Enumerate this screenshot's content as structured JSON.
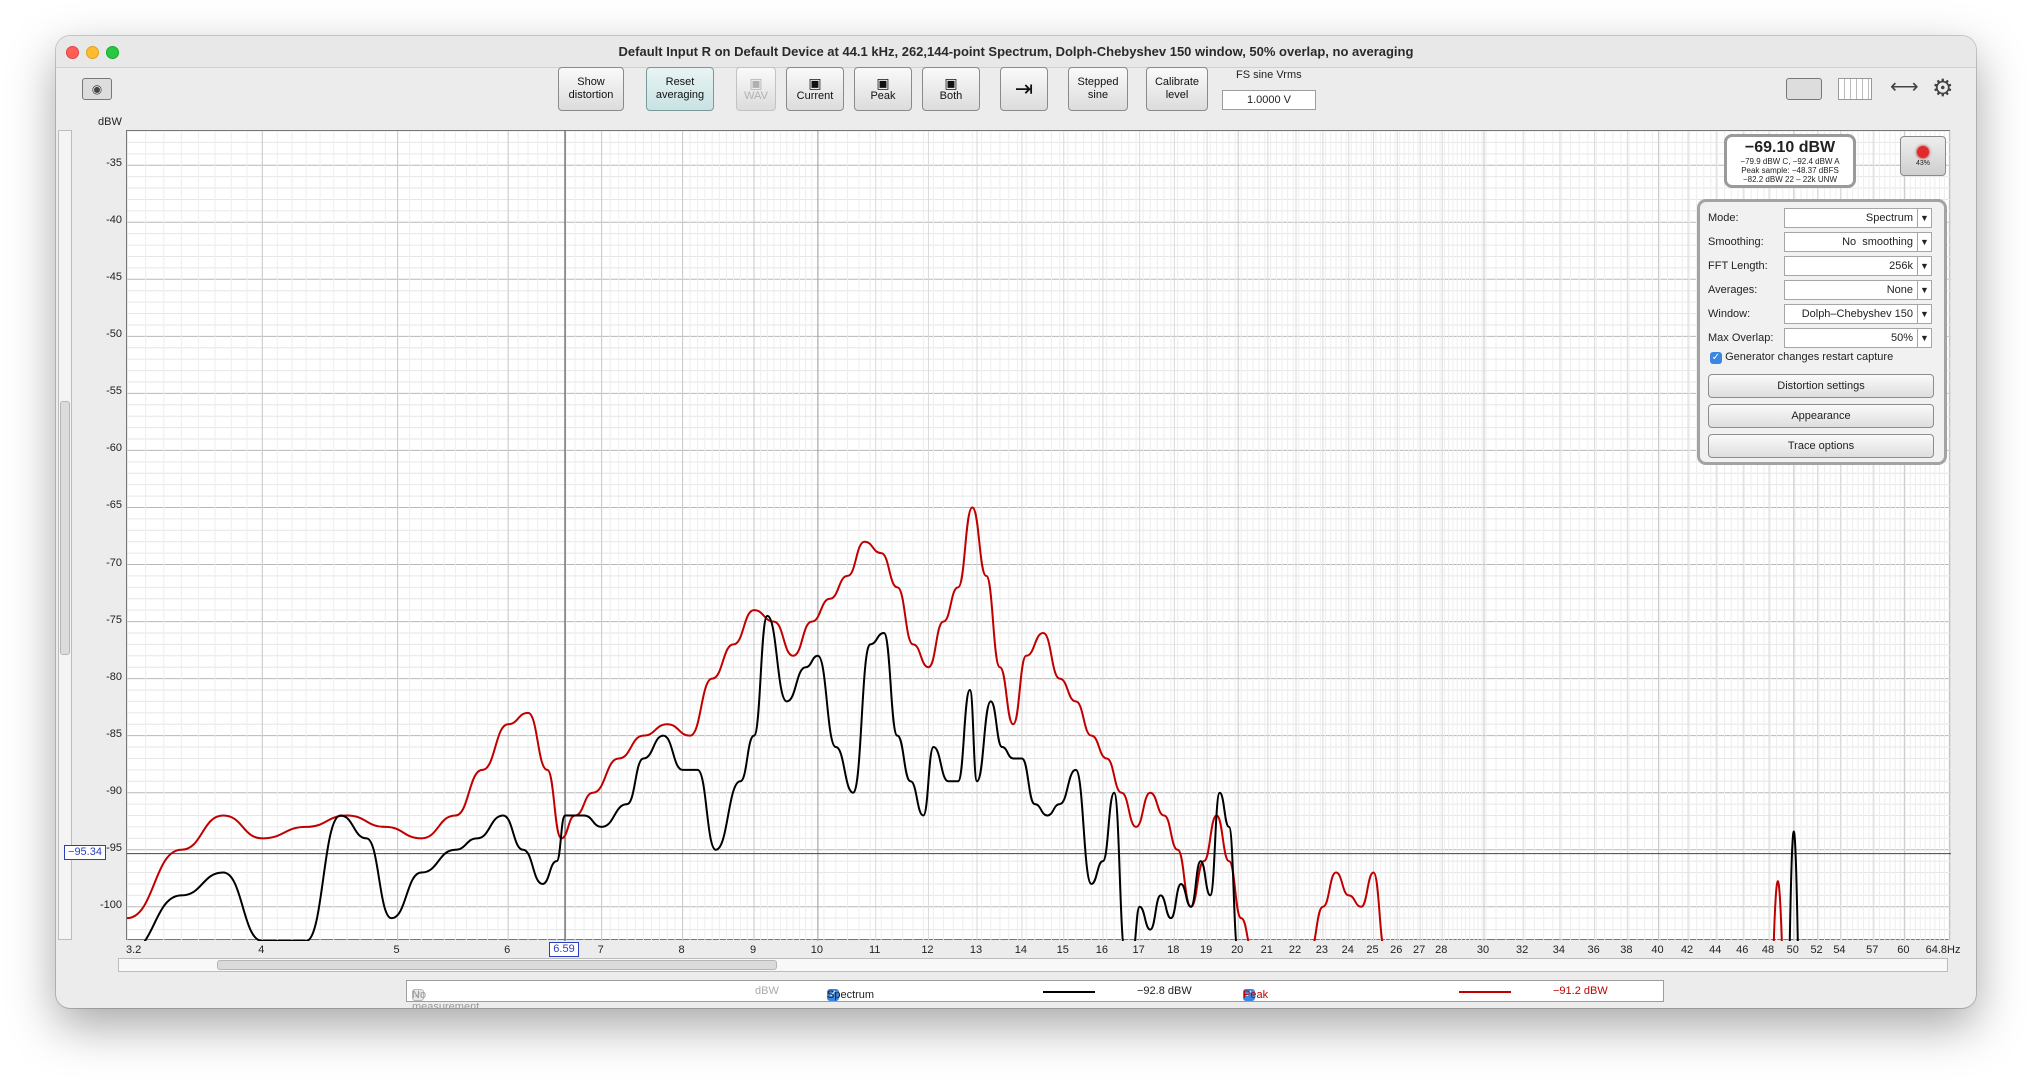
{
  "window": {
    "title": "Default Input R on Default Device at 44.1 kHz, 262,144-point Spectrum, Dolph-Chebyshev 150 window, 50% overlap, no averaging"
  },
  "toolbar": {
    "show_distortion": [
      "Show",
      "distortion"
    ],
    "reset_averaging": [
      "Reset",
      "averaging"
    ],
    "wav": "WAV",
    "current": "Current",
    "peak": "Peak",
    "both": "Both",
    "stepped_sine": [
      "Stepped",
      "sine"
    ],
    "calibrate_level": [
      "Calibrate",
      "level"
    ],
    "fs_label": "FS sine Vrms",
    "fs_value": "1.0000 V"
  },
  "readout": {
    "main": "−69.10 dBW",
    "line1": "−79.9 dBW C, −92.4 dBW A",
    "line2": "Peak sample: −48.37 dBFS",
    "line3": "−82.2 dBW 22 – 22k UNW",
    "record_pct": "43%"
  },
  "panel": {
    "rows": [
      {
        "label": "Mode:",
        "value": "Spectrum"
      },
      {
        "label": "Smoothing:",
        "value": "No  smoothing"
      },
      {
        "label": "FFT Length:",
        "value": "256k"
      },
      {
        "label": "Averages:",
        "value": "None"
      },
      {
        "label": "Window:",
        "value": "Dolph–Chebyshev 150"
      },
      {
        "label": "Max Overlap:",
        "value": "50%"
      }
    ],
    "generator": "Generator changes restart capture",
    "buttons": [
      "Distortion settings",
      "Appearance",
      "Trace options"
    ]
  },
  "legend": {
    "no_measurement": "No measurement",
    "unit": "dBW",
    "spectrum": "Spectrum",
    "spectrum_value": "−92.8 dBW",
    "peak": "Peak",
    "peak_value": "−91.2 dBW"
  },
  "chart_data": {
    "type": "line",
    "ylabel": "dBW",
    "ylim": [
      -103,
      -32
    ],
    "xlim": [
      3.2,
      64.8
    ],
    "x_scale": "log",
    "x_unit": "Hz",
    "grid": true,
    "yticks": [
      "-35",
      "-40",
      "-45",
      "-50",
      "-55",
      "-60",
      "-65",
      "-70",
      "-75",
      "-80",
      "-85",
      "-90",
      "-95",
      "-100"
    ],
    "xticks": [
      "3.2",
      "4",
      "5",
      "6",
      "7",
      "8",
      "9",
      "10",
      "11",
      "12",
      "13",
      "14",
      "15",
      "16",
      "17",
      "18",
      "19",
      "20",
      "21",
      "22",
      "23",
      "24",
      "25",
      "26",
      "27",
      "28",
      "30",
      "32",
      "34",
      "36",
      "38",
      "40",
      "42",
      "44",
      "46",
      "48",
      "50",
      "52",
      "54",
      "57",
      "60",
      "64.8Hz"
    ],
    "cursor": {
      "x": 6.59,
      "x_label": "6.59",
      "y": -95.34,
      "y_label": "−95.34"
    },
    "series": [
      {
        "name": "Spectrum",
        "color": "#000000",
        "x": [
          3.2,
          3.5,
          3.75,
          4.0,
          4.3,
          4.55,
          4.75,
          4.95,
          5.2,
          5.5,
          5.7,
          5.95,
          6.15,
          6.35,
          6.5,
          6.59,
          6.8,
          7.0,
          7.3,
          7.5,
          7.75,
          8.0,
          8.2,
          8.45,
          8.8,
          9.0,
          9.2,
          9.5,
          9.8,
          10.0,
          10.3,
          10.6,
          10.9,
          11.15,
          11.4,
          11.65,
          11.9,
          12.1,
          12.4,
          12.6,
          12.85,
          13.0,
          13.3,
          13.55,
          13.8,
          14.0,
          14.3,
          14.6,
          14.9,
          15.3,
          15.7,
          16.0,
          16.3,
          16.6,
          16.8,
          17.0,
          17.3,
          17.6,
          17.9,
          18.2,
          18.5,
          18.8,
          19.1,
          19.4,
          19.7,
          20.0,
          20.3,
          20.6
        ],
        "y": [
          -104,
          -99,
          -97,
          -103,
          -103,
          -92,
          -94,
          -101,
          -97,
          -95,
          -94,
          -92,
          -95,
          -98,
          -96,
          -92,
          -92,
          -93,
          -91,
          -87,
          -85,
          -88,
          -88,
          -95,
          -89,
          -85,
          -74.5,
          -82,
          -79,
          -78,
          -86,
          -90,
          -77,
          -76,
          -85,
          -89,
          -92,
          -86,
          -89,
          -89,
          -81,
          -89,
          -82,
          -86,
          -87,
          -87,
          -91,
          -92,
          -91,
          -88,
          -98,
          -96,
          -90,
          -104,
          -104,
          -100,
          -102,
          -99,
          -101,
          -98,
          -100,
          -96,
          -99,
          -90,
          -93,
          -104,
          -104,
          -104
        ]
      },
      {
        "name": "Peak",
        "color": "#c00000",
        "x": [
          3.2,
          3.5,
          3.75,
          4.0,
          4.3,
          4.6,
          4.9,
          5.2,
          5.5,
          5.75,
          6.0,
          6.2,
          6.4,
          6.55,
          6.7,
          6.9,
          7.2,
          7.5,
          7.8,
          8.1,
          8.4,
          8.7,
          9.0,
          9.3,
          9.6,
          9.9,
          10.2,
          10.5,
          10.8,
          11.1,
          11.4,
          11.7,
          12.0,
          12.3,
          12.6,
          12.9,
          13.2,
          13.5,
          13.8,
          14.1,
          14.5,
          14.9,
          15.3,
          15.7,
          16.1,
          16.5,
          16.9,
          17.3,
          17.7,
          18.1,
          18.5,
          18.9,
          19.3,
          19.7,
          20.1,
          20.5,
          20.9,
          21.5,
          22.0,
          22.5,
          23.0,
          23.5,
          24.0,
          24.5,
          25.0,
          25.5,
          26.0,
          26.5,
          27.0
        ],
        "y": [
          -101,
          -95,
          -92,
          -94,
          -93,
          -92,
          -93,
          -94,
          -92,
          -88,
          -84,
          -83,
          -88,
          -94,
          -92,
          -90,
          -87,
          -85,
          -84,
          -85,
          -80,
          -77,
          -74,
          -75,
          -78,
          -75,
          -73,
          -71,
          -68,
          -69,
          -72,
          -77,
          -79,
          -75,
          -72,
          -65,
          -71,
          -79,
          -84,
          -78,
          -76,
          -80,
          -82,
          -85,
          -87,
          -90,
          -93,
          -90,
          -92,
          -95,
          -100,
          -96,
          -92,
          -96,
          -101,
          -104,
          -104,
          -104,
          -104,
          -104,
          -100,
          -97,
          -99,
          -100,
          -97,
          -104,
          -104,
          -104,
          -104
        ]
      }
    ]
  }
}
